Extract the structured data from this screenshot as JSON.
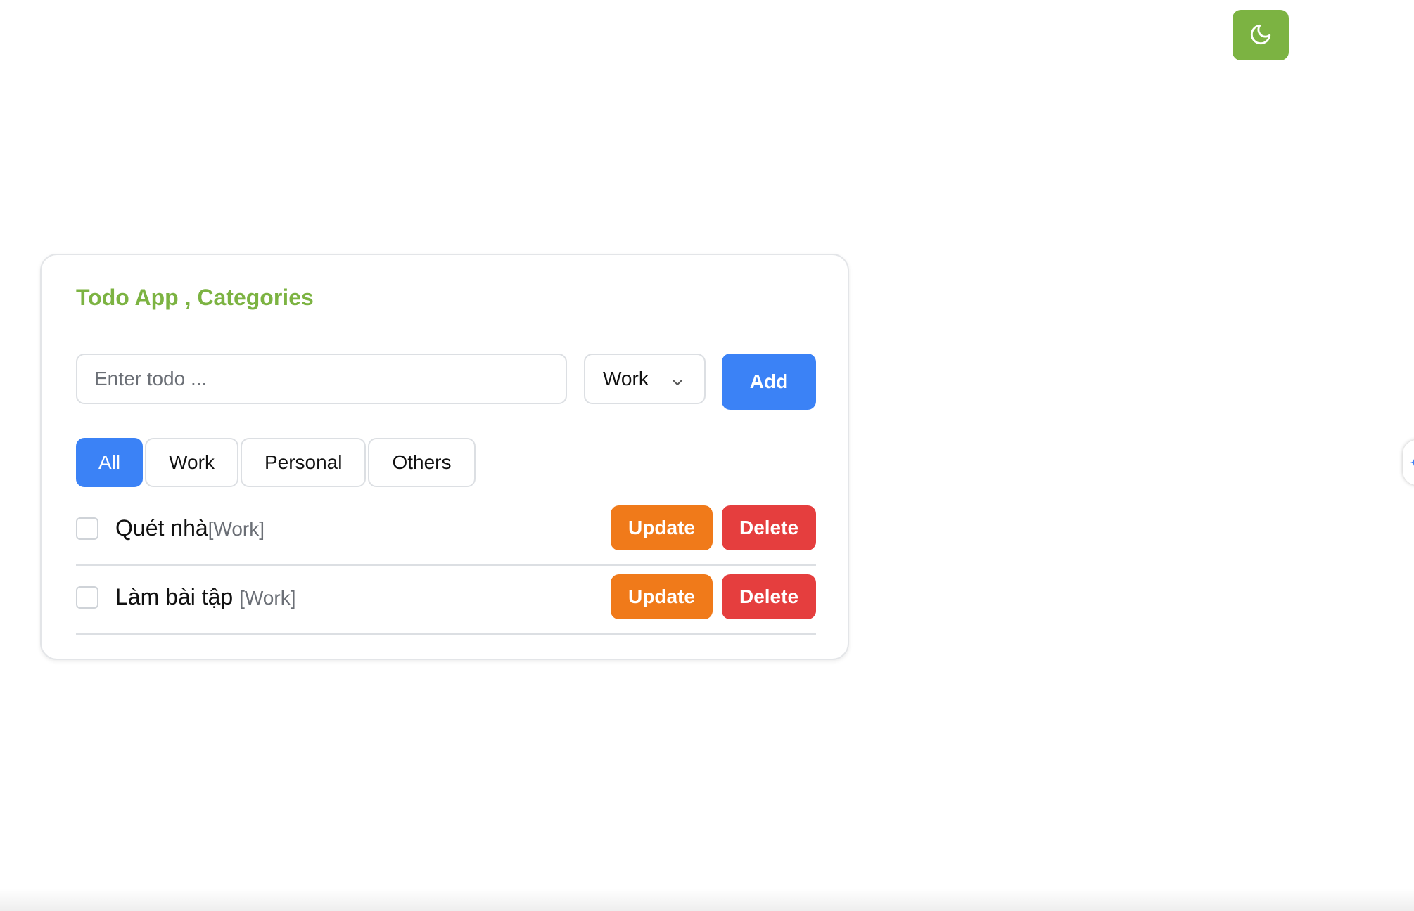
{
  "theme_toggle": {
    "icon": "moon-icon",
    "color": "#7cb342"
  },
  "app": {
    "title": "Todo App , Categories",
    "title_color": "#7cb342",
    "input": {
      "value": "",
      "placeholder": "Enter todo ..."
    },
    "category_select": {
      "selected": "Work",
      "icon": "chevron-down-icon"
    },
    "add_label": "Add",
    "accent": "#3b82f6",
    "filters": [
      {
        "label": "All",
        "active": true
      },
      {
        "label": "Work",
        "active": false
      },
      {
        "label": "Personal",
        "active": false
      },
      {
        "label": "Others",
        "active": false
      }
    ],
    "todos": [
      {
        "text": "Quét nhà",
        "category": "[Work]",
        "checked": false,
        "update_label": "Update",
        "delete_label": "Delete"
      },
      {
        "text": "Làm bài tập ",
        "category": "[Work]",
        "checked": false,
        "update_label": "Update",
        "delete_label": "Delete"
      }
    ],
    "update_color": "#f07a1a",
    "delete_color": "#e53e3e"
  }
}
